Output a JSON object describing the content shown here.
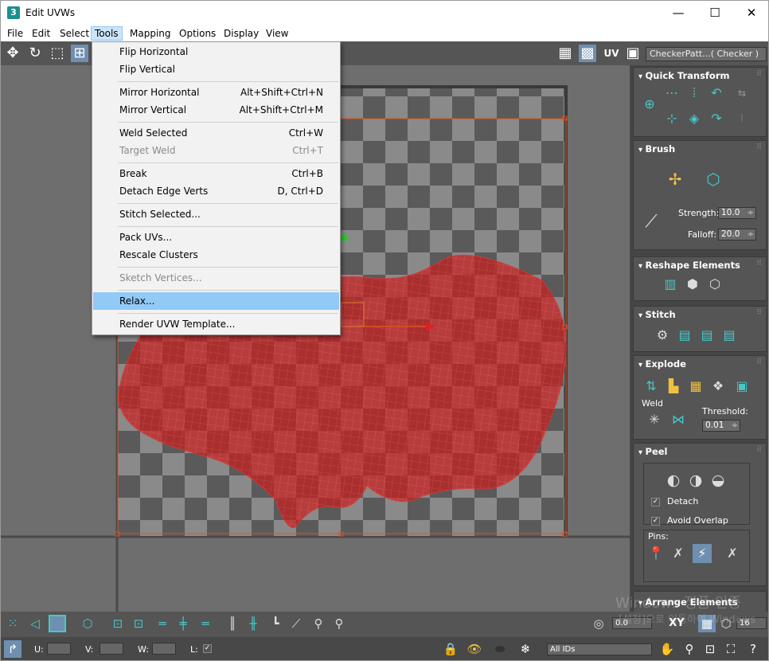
{
  "window": {
    "title": "Edit UVWs",
    "app_icon": "3",
    "minimize": "—",
    "maximize": "☐",
    "close": "✕"
  },
  "menu": [
    "File",
    "Edit",
    "Select",
    "Tools",
    "Mapping",
    "Options",
    "Display",
    "View"
  ],
  "toolbar": {
    "uv_label": "UV",
    "checker_select": "CheckerPatt...( Checker )"
  },
  "tools_menu": {
    "flip_horizontal": "Flip Horizontal",
    "flip_vertical": "Flip Vertical",
    "mirror_horizontal": "Mirror Horizontal",
    "mirror_horizontal_sc": "Alt+Shift+Ctrl+N",
    "mirror_vertical": "Mirror Vertical",
    "mirror_vertical_sc": "Alt+Shift+Ctrl+M",
    "weld_selected": "Weld Selected",
    "weld_selected_sc": "Ctrl+W",
    "target_weld": "Target Weld",
    "target_weld_sc": "Ctrl+T",
    "break": "Break",
    "break_sc": "Ctrl+B",
    "detach_edge_verts": "Detach Edge Verts",
    "detach_edge_verts_sc": "D, Ctrl+D",
    "stitch_selected": "Stitch Selected...",
    "pack_uvs": "Pack UVs...",
    "rescale_clusters": "Rescale Clusters",
    "sketch_vertices": "Sketch Vertices...",
    "relax": "Relax...",
    "render_uvw_template": "Render UVW Template..."
  },
  "panel": {
    "quick_transform": "Quick Transform",
    "brush": "Brush",
    "strength_label": "Strength:",
    "strength_value": "10.0",
    "falloff_label": "Falloff:",
    "falloff_value": "20.0",
    "reshape": "Reshape Elements",
    "stitch": "Stitch",
    "explode": "Explode",
    "weld": "Weld",
    "threshold_label": "Threshold:",
    "threshold_value": "0.01",
    "peel": "Peel",
    "detach": "Detach",
    "avoid_overlap": "Avoid Overlap",
    "pins": "Pins:",
    "arrange": "Arrange Elements"
  },
  "bottom": {
    "u_label": "U:",
    "v_label": "V:",
    "w_label": "W:",
    "l_label": "L:",
    "all_ids": "All IDs",
    "xy": "XY",
    "value_0": "0.0",
    "value_16": "16"
  },
  "watermark": {
    "line1": "Windows 정품 인증",
    "line2": "[설정]으로 이동하여 Windows"
  },
  "colors": {
    "uv_mesh": "#c81e1e",
    "menu_highlight": "#91c9f7",
    "arrow": "#e81010",
    "accent_teal": "#46c8c8"
  }
}
